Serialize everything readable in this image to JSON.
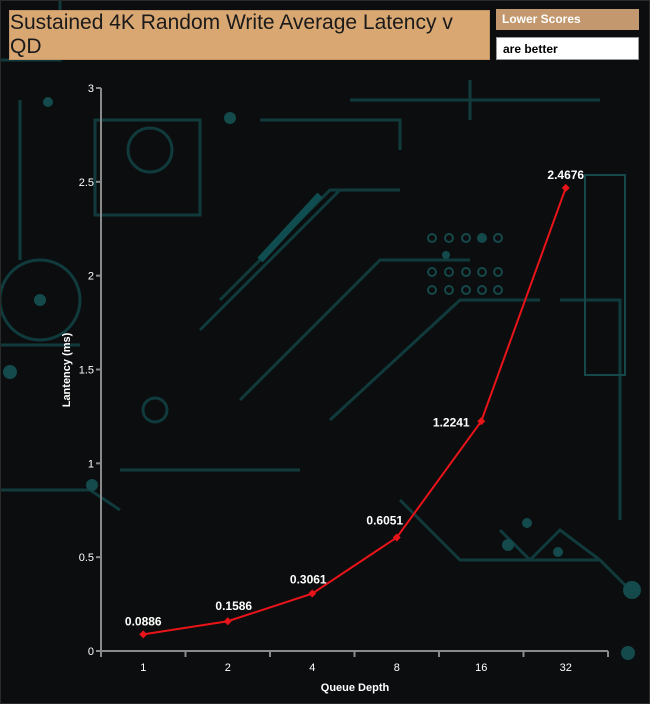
{
  "title": "Sustained 4K Random Write Average Latency v QD",
  "legend": {
    "line1": "Lower Scores",
    "line2": "are better"
  },
  "colors": {
    "series": "#e8141a",
    "axis": "#8a8a8a",
    "text": "#ffffff",
    "title_bg": "#d9a772"
  },
  "chart_data": {
    "type": "line",
    "title": "Sustained 4K Random Write Average Latency v QD",
    "xlabel": "Queue Depth",
    "ylabel": "Lantency (ms)",
    "categories": [
      "1",
      "2",
      "4",
      "8",
      "16",
      "32"
    ],
    "ylim": [
      0,
      3
    ],
    "yticks": [
      "0",
      "0.5",
      "1",
      "1.5",
      "2",
      "2.5",
      "3"
    ],
    "series": [
      {
        "values": [
          0.0886,
          0.1586,
          0.3061,
          0.6051,
          1.2241,
          2.4676
        ],
        "labels": [
          "0.0886",
          "0.1586",
          "0.3061",
          "0.6051",
          "1.2241",
          "2.4676"
        ]
      }
    ],
    "grid": false
  }
}
